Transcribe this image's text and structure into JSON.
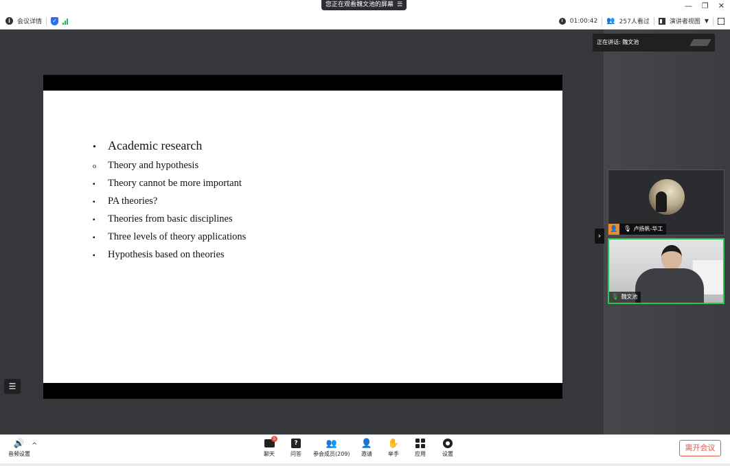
{
  "titlebar": {
    "viewing_text": "您正在观看魏文池的屏幕",
    "viewing_icon": "list-icon",
    "minimize": "—",
    "restore": "❐",
    "close": "✕"
  },
  "infobar": {
    "meeting_details": "会议详情",
    "timer": "01:00:42",
    "viewers": "257人看过",
    "view_mode": "演讲者视图"
  },
  "slide": {
    "bullets": [
      {
        "mark": "•",
        "text": "Academic research"
      },
      {
        "mark": "o",
        "text": "Theory and hypothesis"
      },
      {
        "mark": "▪",
        "text": "Theory cannot be more important"
      },
      {
        "mark": "▪",
        "text": "PA theories?"
      },
      {
        "mark": "▪",
        "text": "Theories from basic disciplines"
      },
      {
        "mark": "▪",
        "text": "Three levels of theory applications"
      },
      {
        "mark": "▪",
        "text": "Hypothesis based on theories"
      }
    ]
  },
  "panel": {
    "speaking_label": "正在讲话:",
    "speaking_name": "魏文池",
    "tiles": [
      {
        "name": "卢扬帆-华工",
        "host": true
      },
      {
        "name": "魏文池",
        "host": false
      }
    ]
  },
  "toolbar": {
    "audio_settings": "音频设置",
    "chat": "聊天",
    "chat_badge": "5",
    "qa": "问答",
    "participants": "参会成员(209)",
    "invite": "邀请",
    "raise_hand": "举手",
    "apps": "应用",
    "settings": "设置",
    "leave": "离开会议"
  },
  "colors": {
    "accent_blue": "#2f6ee8",
    "signal_green": "#1fb45a",
    "speaking_border": "#2bc552",
    "leave_red": "#e2574c",
    "host_orange": "#f08a24"
  }
}
